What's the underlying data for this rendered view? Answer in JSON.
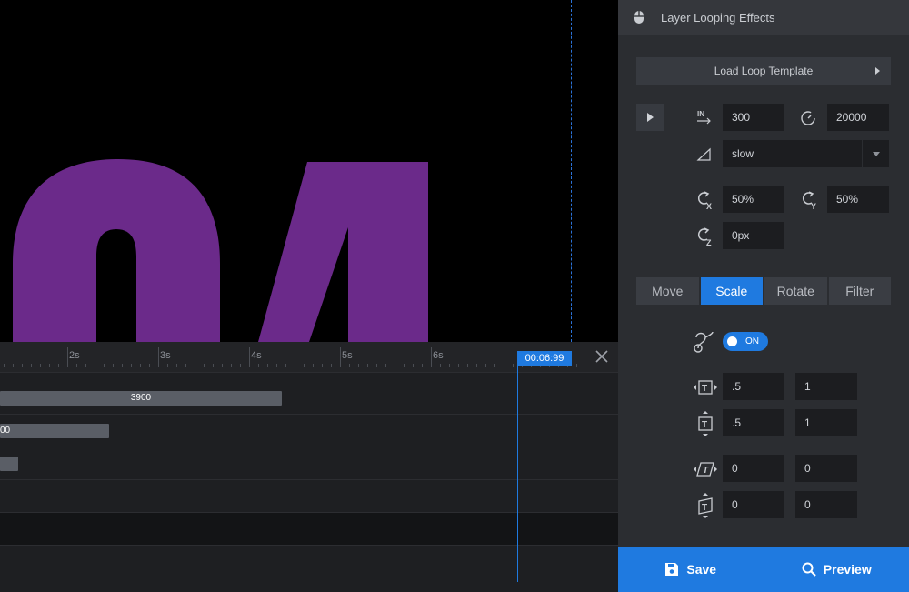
{
  "canvas": {
    "text_color": "#6b2a8a",
    "guide_color": "#2b73d8"
  },
  "timeline": {
    "ruler_labels": [
      "2s",
      "3s",
      "4s",
      "5s",
      "6s"
    ],
    "time_badge": "00:06:99",
    "tracks": [
      {
        "label": "3900"
      },
      {
        "label": "00"
      },
      {
        "label": ""
      },
      {
        "label": ""
      },
      {
        "label": ""
      }
    ],
    "accent": "#1f7ae0"
  },
  "panel": {
    "title": "Layer Looping Effects",
    "header_icon": "mouse-icon",
    "load_template_label": "Load Loop Template",
    "loop": {
      "in_value": "300",
      "speed_value": "20000",
      "ease_value": "slow",
      "origin_x_value": "50%",
      "origin_y_value": "50%",
      "origin_z_value": "0px"
    },
    "tabs": [
      "Move",
      "Scale",
      "Rotate",
      "Filter"
    ],
    "active_tab": "Scale",
    "toggle_label": "ON",
    "scale": {
      "scale_x_from": ".5",
      "scale_x_to": "1",
      "scale_y_from": ".5",
      "scale_y_to": "1",
      "skew_x_from": "0",
      "skew_x_to": "0",
      "skew_y_from": "0",
      "skew_y_to": "0"
    }
  },
  "footer": {
    "save_label": "Save",
    "preview_label": "Preview"
  }
}
